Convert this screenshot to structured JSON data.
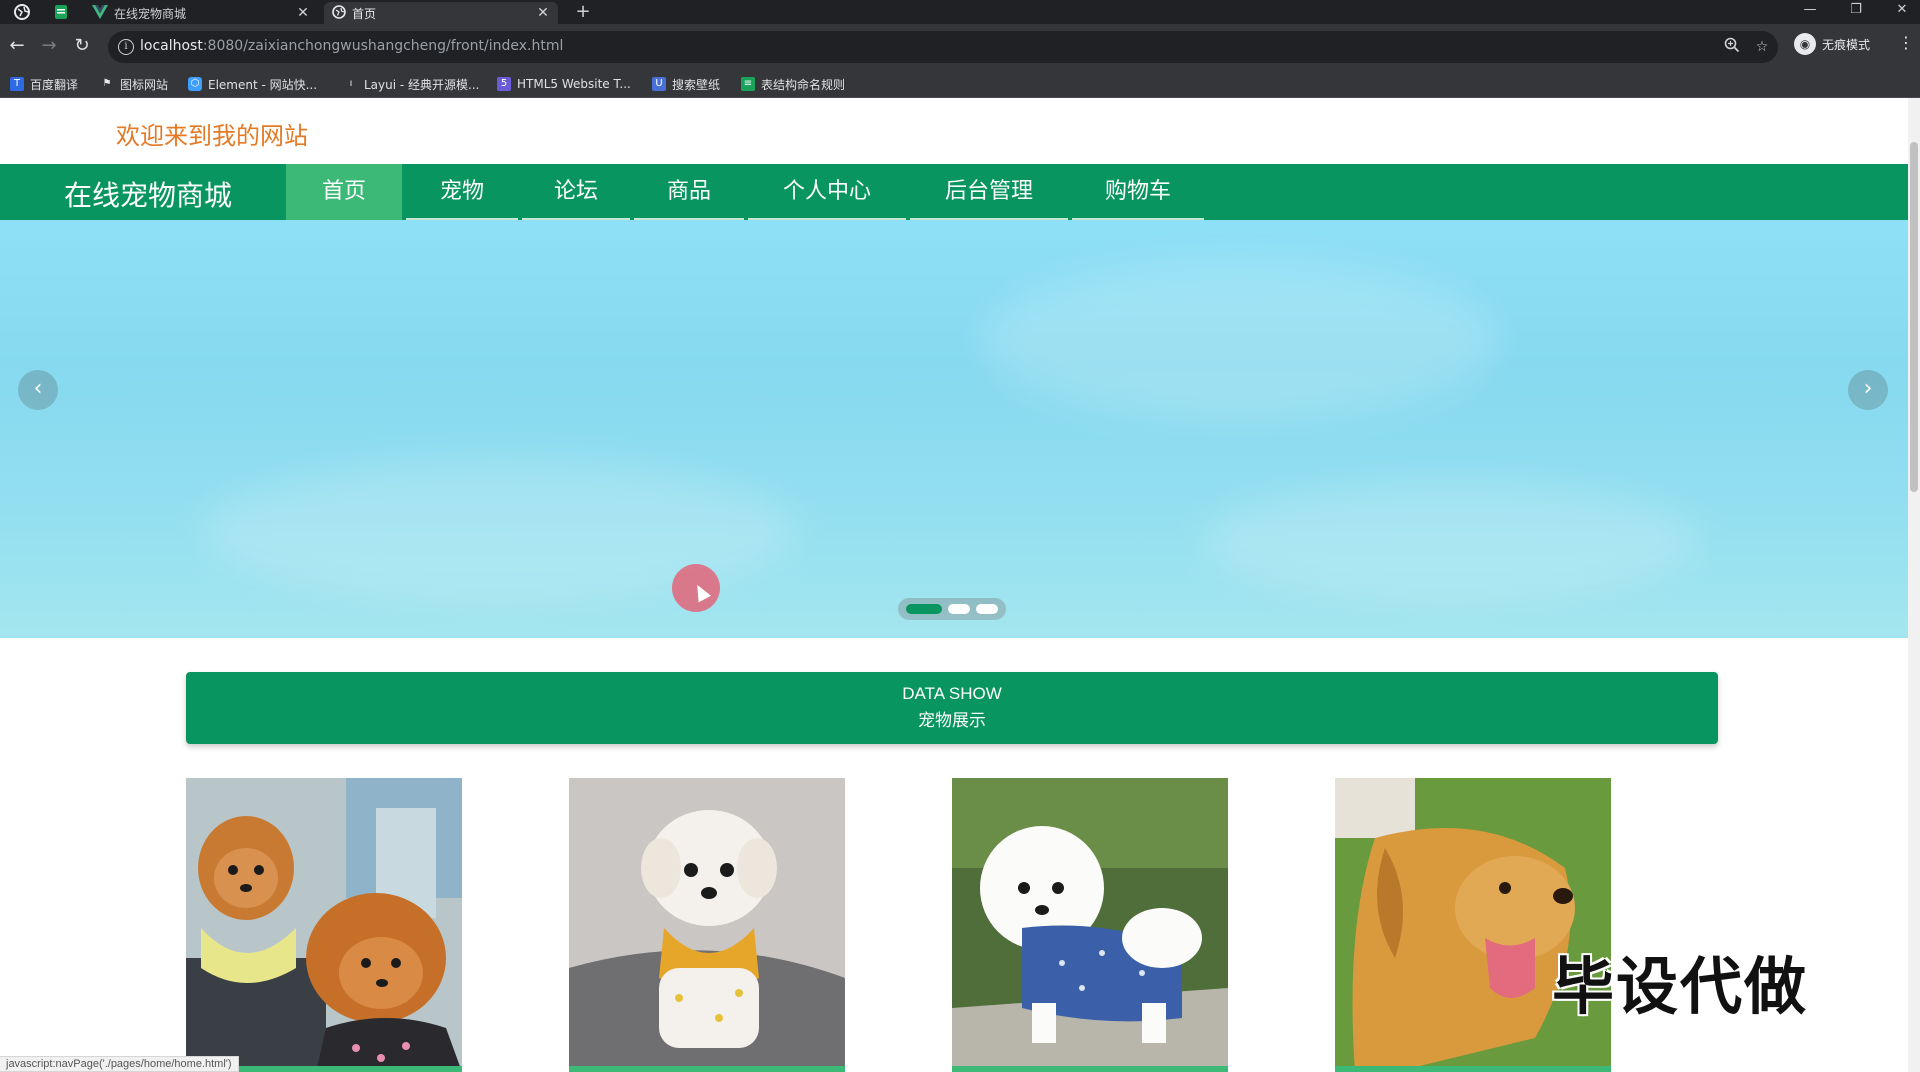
{
  "browser": {
    "tabs": [
      {
        "label": "在线宠物商城",
        "close": "✕",
        "active": false
      },
      {
        "label": "首页",
        "close": "✕",
        "active": true
      }
    ],
    "new_tab": "+",
    "window_controls": {
      "minimize": "—",
      "restore": "❐",
      "close": "✕"
    },
    "url_host": "localhost",
    "url_rest": ":8080/zaixianchongwushangcheng/front/index.html",
    "profile_label": "无痕模式",
    "bookmarks": [
      {
        "label": "百度翻译",
        "icon": "baidu-translate-icon",
        "color": "#2f6ae5"
      },
      {
        "label": "图标网站",
        "icon": "flag-icon",
        "color": "#35363a"
      },
      {
        "label": "Element - 网站快...",
        "icon": "element-icon",
        "color": "#409eff"
      },
      {
        "label": "Layui - 经典开源模...",
        "icon": "layui-icon",
        "color": "#35363a"
      },
      {
        "label": "HTML5 Website T...",
        "icon": "html5-icon",
        "color": "#6b5bd6"
      },
      {
        "label": "搜索壁纸",
        "icon": "wallpaper-icon",
        "color": "#4a6fd6"
      },
      {
        "label": "表结构命名规则",
        "icon": "sheet-icon",
        "color": "#1aa35b"
      }
    ]
  },
  "site": {
    "welcome": "欢迎来到我的网站",
    "brand": "在线宠物商城",
    "nav": [
      "首页",
      "宠物",
      "论坛",
      "商品",
      "个人中心",
      "后台管理",
      "购物车"
    ],
    "active_nav": "首页",
    "carousel": {
      "slide_count": 3,
      "active_index": 0,
      "prev": "‹",
      "next": "›"
    },
    "section_en": "DATA SHOW",
    "section_cn": "宠物展示",
    "pets": [
      {
        "name": "pomeranian-photo"
      },
      {
        "name": "white-puppy-photo"
      },
      {
        "name": "bichon-photo"
      },
      {
        "name": "golden-retriever-photo"
      }
    ],
    "watermark": "毕设代做",
    "status_text": "javascript:navPage('./pages/home/home.html')"
  },
  "colors": {
    "primary": "#08955f",
    "nav_active": "#3cb877",
    "welcome": "#e57a25",
    "chrome_dark": "#35363a"
  }
}
